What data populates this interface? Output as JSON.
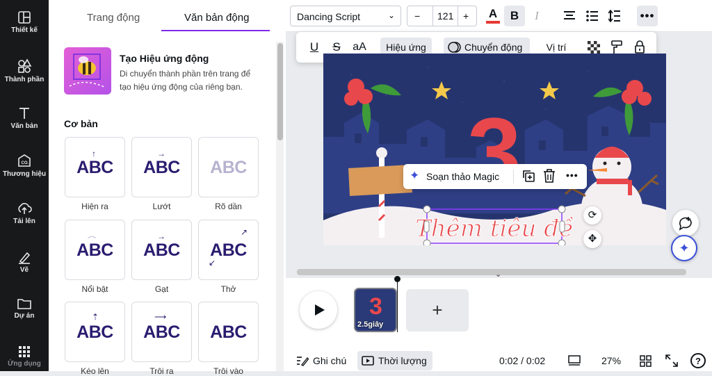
{
  "sidebar": {
    "items": [
      {
        "label": "Thiết kế",
        "icon": "layout-icon"
      },
      {
        "label": "Thành phần",
        "icon": "shapes-icon"
      },
      {
        "label": "Văn bản",
        "icon": "text-icon"
      },
      {
        "label": "Thương hiệu",
        "icon": "brand-icon"
      },
      {
        "label": "Tải lên",
        "icon": "upload-cloud-icon"
      },
      {
        "label": "Vẽ",
        "icon": "draw-icon"
      },
      {
        "label": "Dự án",
        "icon": "folder-icon"
      },
      {
        "label": "Ứng dụng",
        "icon": "apps-grid-icon"
      }
    ]
  },
  "panel": {
    "tabs": [
      "Trang động",
      "Văn bản động"
    ],
    "promo": {
      "title": "Tạo Hiệu ứng động",
      "description": "Di chuyển thành phần trên trang để tạo hiệu ứng động của riêng bạn."
    },
    "section_title": "Cơ bản",
    "cards": [
      {
        "label": "Hiện ra",
        "sample": "ABC"
      },
      {
        "label": "Lướt",
        "sample": "ABC"
      },
      {
        "label": "Rõ dần",
        "sample": "ABC"
      },
      {
        "label": "Nổi bật",
        "sample": "ABC"
      },
      {
        "label": "Gạt",
        "sample": "ABC"
      },
      {
        "label": "Thở",
        "sample": "ABC"
      },
      {
        "label": "Kéo lên",
        "sample": "ABC"
      },
      {
        "label": "Trôi ra",
        "sample": "ABC"
      },
      {
        "label": "Trôi vào",
        "sample": "ABC"
      }
    ]
  },
  "toolbar": {
    "font": "Dancing Script",
    "font_size": "121",
    "minus": "−",
    "plus": "+",
    "text_color": "#e53935"
  },
  "float_toolbar": {
    "effects": "Hiệu ứng",
    "animate": "Chuyển động",
    "position": "Vị trí",
    "case": "aA"
  },
  "canvas": {
    "number": "3",
    "title_text": "Thêm tiêu đề",
    "context_menu": {
      "magic_edit": "Soạn thảo Magic"
    }
  },
  "timeline": {
    "clip_duration": "2.5giây",
    "clip_number": "3",
    "add_page": "+"
  },
  "bottom": {
    "notes": "Ghi chú",
    "duration": "Thời lượng",
    "time": "0:02 / 0:02",
    "zoom": "27%",
    "help": "?"
  },
  "colors": {
    "accent": "#7d2ae8",
    "canvas_bg": "#26346e",
    "number_red": "#e8484c"
  }
}
